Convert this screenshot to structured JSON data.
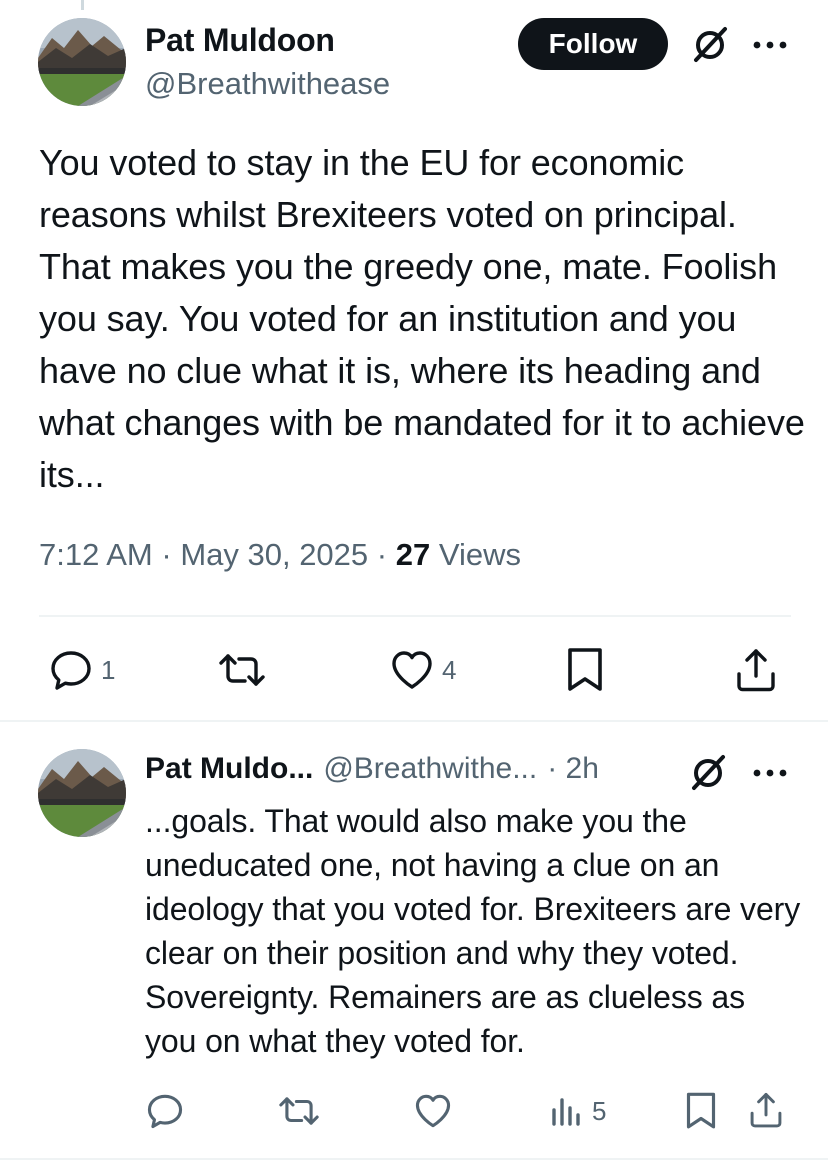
{
  "main_tweet": {
    "author_name": "Pat Muldoon",
    "author_handle": "@Breathwithease",
    "follow_label": "Follow",
    "text": "You voted to stay in the EU for economic reasons whilst Brexiteers voted on principal. That makes you the greedy one, mate. Foolish you say. You voted for an institution and you have no clue what it is, where its heading and what changes with be mandated for it to achieve its...",
    "time": "7:12 AM",
    "date": "May 30, 2025",
    "views_count": "27",
    "views_label": "Views",
    "actions": {
      "reply_count": "1",
      "like_count": "4"
    }
  },
  "reply_tweet": {
    "author_name": "Pat Muldo...",
    "author_handle": "@Breathwithe...",
    "time": "2h",
    "text": "...goals. That would also make you the uneducated one, not having a clue on an ideology that you voted for. Brexiteers are very clear on their position and why they voted. Sovereignty. Remainers are as clueless as you on what they voted for.",
    "actions": {
      "views_count": "5"
    }
  },
  "colors": {
    "text_primary": "#0f1419",
    "text_secondary": "#536471",
    "divider": "#eff3f4",
    "follow_bg": "#0f1419"
  },
  "icons": [
    "reply-icon",
    "retweet-icon",
    "like-icon",
    "bookmark-icon",
    "share-icon",
    "views-icon",
    "grok-icon",
    "more-icon"
  ]
}
